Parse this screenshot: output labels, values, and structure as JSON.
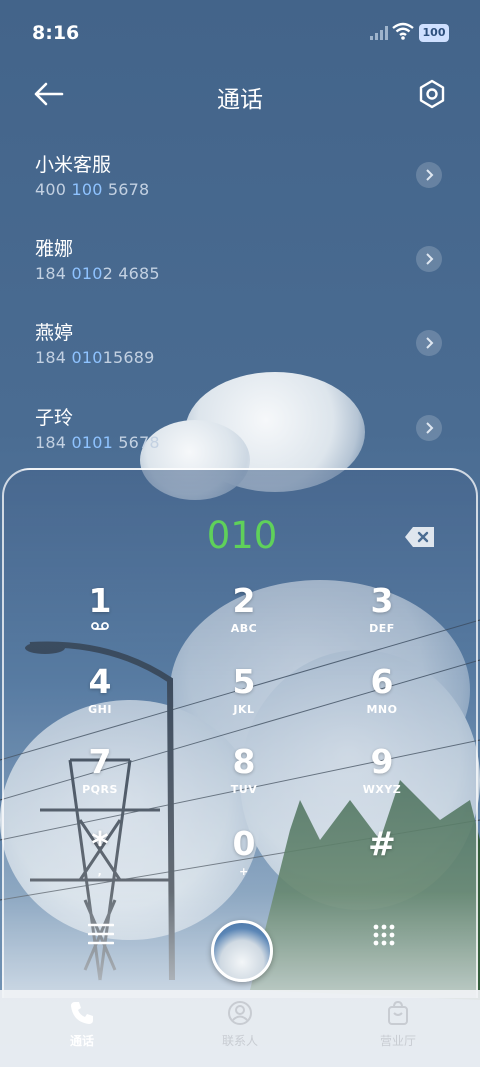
{
  "status_bar": {
    "time": "8:16",
    "battery": "100"
  },
  "header": {
    "title": "通话"
  },
  "contacts": [
    {
      "name": "小米客服",
      "number_parts": [
        "400 ",
        "100",
        " 5678"
      ]
    },
    {
      "name": "雅娜",
      "number_parts": [
        "184 ",
        "010",
        "2 4685"
      ]
    },
    {
      "name": "燕婷",
      "number_parts": [
        "184 ",
        "010",
        "15689"
      ]
    },
    {
      "name": "子玲",
      "number_parts": [
        "184 ",
        "0101",
        " 5678"
      ]
    }
  ],
  "dialpad": {
    "dialed": "010",
    "keys": [
      {
        "digit": "1",
        "letters": ""
      },
      {
        "digit": "2",
        "letters": "ABC"
      },
      {
        "digit": "3",
        "letters": "DEF"
      },
      {
        "digit": "4",
        "letters": "GHI"
      },
      {
        "digit": "5",
        "letters": "JKL"
      },
      {
        "digit": "6",
        "letters": "MNO"
      },
      {
        "digit": "7",
        "letters": "PQRS"
      },
      {
        "digit": "8",
        "letters": "TUV"
      },
      {
        "digit": "9",
        "letters": "WXYZ"
      },
      {
        "digit": "*",
        "letters": ","
      },
      {
        "digit": "0",
        "letters": "+"
      },
      {
        "digit": "#",
        "letters": ""
      }
    ]
  },
  "bottom_nav": {
    "calls": "通话",
    "contacts": "联系人",
    "service": "营业厅"
  },
  "colors": {
    "dialed_number": "#5fd15a",
    "highlight": "#8fc3ff",
    "accent_bg": "#43648a"
  }
}
